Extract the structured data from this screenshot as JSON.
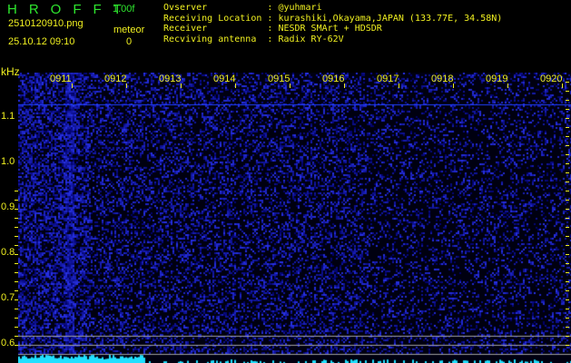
{
  "header": {
    "logo": "HROFFT",
    "version": "1.00f",
    "filename": "2510120910.png",
    "datetime": "25.10.12 09:10",
    "meteor_label": "meteor",
    "meteor_count": "0"
  },
  "info": [
    {
      "label": "Ovserver          ",
      "value": "@yuhmari"
    },
    {
      "label": "Receiving Location",
      "value": "kurashiki,Okayama,JAPAN (133.77E, 34.58N)"
    },
    {
      "label": "Receiver          ",
      "value": "NESDR SMArt + HDSDR"
    },
    {
      "label": "Recviving antenna ",
      "value": "Radix RY-62V"
    }
  ],
  "axis": {
    "y_unit": "kHz",
    "y_labels": [
      "1.1",
      "1.0",
      "0.9",
      "0.8",
      "0.7",
      "0.6"
    ],
    "x_labels": [
      "0911",
      "0912",
      "0913",
      "0914",
      "0915",
      "0916",
      "0917",
      "0918",
      "0919",
      "0920"
    ]
  },
  "colors": {
    "logo": "#2ee62e",
    "text": "#f0f020",
    "noise": "#1a2ad0",
    "spectrum": "#20e0ff"
  }
}
